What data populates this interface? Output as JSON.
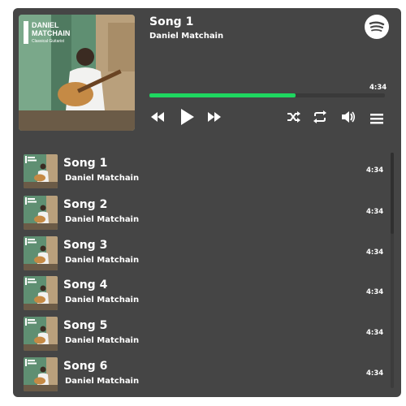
{
  "now_playing": {
    "title": "Song 1",
    "artist": "Daniel Matchain",
    "duration": "4:34",
    "progress": 0.62,
    "cover_text": {
      "line1": "DANIEL",
      "line2": "MATCHAIN",
      "line3": "Classical Guitarist"
    }
  },
  "controls": {
    "icons": [
      "rewind-icon",
      "play-icon",
      "fast-forward-icon",
      "shuffle-icon",
      "repeat-icon",
      "volume-icon",
      "menu-icon"
    ]
  },
  "playlist": [
    {
      "title": "Song 1",
      "artist": "Daniel Matchain",
      "duration": "4:34"
    },
    {
      "title": "Song 2",
      "artist": "Daniel Matchain",
      "duration": "4:34"
    },
    {
      "title": "Song 3",
      "artist": "Daniel Matchain",
      "duration": "4:34"
    },
    {
      "title": "Song 4",
      "artist": "Daniel Matchain",
      "duration": "4:34"
    },
    {
      "title": "Song 5",
      "artist": "Daniel Matchain",
      "duration": "4:34"
    },
    {
      "title": "Song 6",
      "artist": "Daniel Matchain",
      "duration": "4:34"
    }
  ],
  "colors": {
    "background": "#454545",
    "accent": "#1ed760",
    "text": "#ffffff"
  }
}
